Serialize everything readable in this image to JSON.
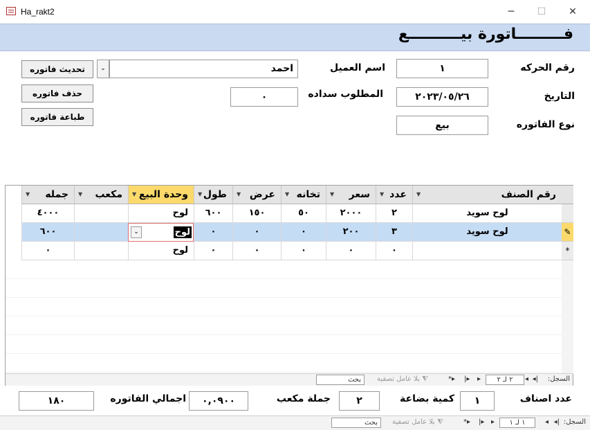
{
  "window": {
    "title": "Ha_rakt2",
    "minimize": "─",
    "maximize": "☐",
    "close": "✕"
  },
  "form": {
    "title": "فـــــــــاتورة بيــــــــــع"
  },
  "fields": {
    "transaction_no_label": "رقم الحركه",
    "transaction_no": "١",
    "date_label": "التاريخ",
    "date": "٢٠٢٣/٠٥/٢٦",
    "invoice_type_label": "نوع الفاتوره",
    "invoice_type": "بيع",
    "customer_label": "اسم العميل",
    "customer": "احمد",
    "due_label": "المطلوب سداده",
    "due": "٠"
  },
  "buttons": {
    "update": "تحديث  فاتوره",
    "delete": "حذف فاتوره",
    "print": "طباعة فاتوره"
  },
  "grid": {
    "columns": [
      "رقم الصنف",
      "عدد",
      "سعر",
      "تخانه",
      "عرض",
      "طول",
      "وحدة البيع",
      "مكعب",
      "جمله"
    ],
    "rows": [
      [
        "لوح سويد",
        "٢",
        "٢٠٠٠",
        "٥٠",
        "١٥٠",
        "٦٠٠",
        "لوح",
        "",
        "٤٠٠٠"
      ],
      [
        "لوح سويد",
        "٣",
        "٢٠٠",
        "٠",
        "٠",
        "٠",
        "لوح",
        "",
        "٦٠٠"
      ],
      [
        "",
        "٠",
        "٠",
        "٠",
        "٠",
        "٠",
        "لوح",
        "",
        "٠"
      ]
    ],
    "new_row_marker": "*",
    "edit_marker": "✎"
  },
  "grid_nav": {
    "record_label": "السجل:",
    "position": "٢ لـ ٢",
    "filter": "بلا عامل تصفية",
    "search": "بحث"
  },
  "totals": {
    "item_count_label": "عدد اصناف",
    "item_count": "١",
    "quantity_label": "كمية بضاعة",
    "cubic_total_label": "جملة مكعب",
    "cubic_total": "٢",
    "cubic_value": "٠,٠٩٠٠",
    "invoice_total_label": "اجمالي الفاتوره",
    "invoice_total": "١٨٠"
  },
  "form_nav": {
    "record_label": "السجل:",
    "position": "١ لـ ١",
    "filter": "بلا عامل تصفية",
    "search": "بحث"
  }
}
